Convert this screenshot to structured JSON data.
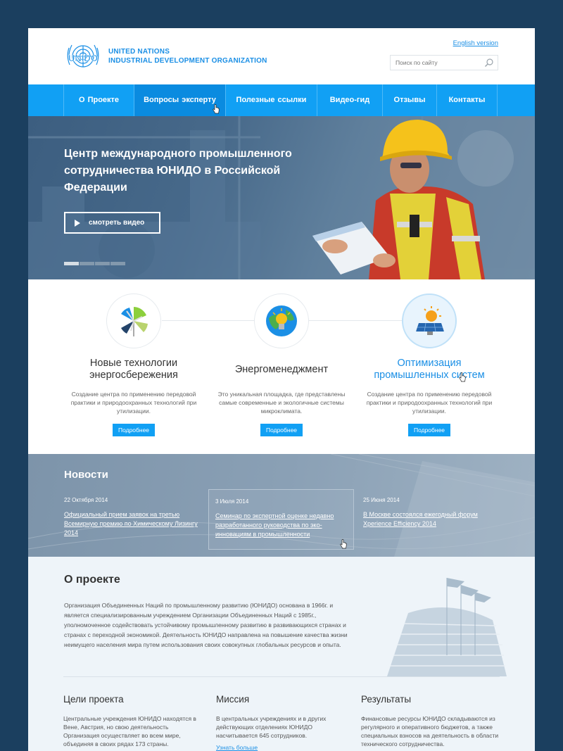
{
  "header": {
    "org_line1": "UNITED NATIONS",
    "org_line2": "INDUSTRIAL DEVELOPMENT ORGANIZATION",
    "logo_text": "UNIDO",
    "lang_link": "English version",
    "search_placeholder": "Поиск по сайту"
  },
  "nav": {
    "items": [
      {
        "label": "О Проекте"
      },
      {
        "label": "Вопросы эксперту"
      },
      {
        "label": "Полезные ссылки"
      },
      {
        "label": "Видео-гид"
      },
      {
        "label": "Отзывы"
      },
      {
        "label": "Контакты"
      }
    ],
    "active_index": 1
  },
  "hero": {
    "title": "Центр международного промышленного сотрудничества ЮНИДО в Российской Федерации",
    "button_label": "смотреть видео",
    "slides_count": 4,
    "active_slide": 0
  },
  "features": [
    {
      "icon": "wind-turbine-icon",
      "title": "Новые технологии энергосбережения",
      "text": "Создание центра по применению передовой практики и природоохранных технологий при утилизации.",
      "button": "Подробнее",
      "highlighted": false
    },
    {
      "icon": "lightbulb-globe-icon",
      "title": "Энергоменеджмент",
      "text": "Это уникальная площадка, где представлены самые современные и экологичные системы микроклимата.",
      "button": "Подробнее",
      "highlighted": false
    },
    {
      "icon": "solar-panel-icon",
      "title": "Оптимизация промышленных систем",
      "text": "Создание центра по применению передовой практики и природоохранных технологий при утилизации.",
      "button": "Подробнее",
      "highlighted": true
    }
  ],
  "news": {
    "heading": "Новости",
    "items": [
      {
        "date": "22 Октября 2014",
        "title": "Официальный прием заявок на третью Всемирную премию по Химическому Лизингу 2014"
      },
      {
        "date": "3 Июля 2014",
        "title": "Семинар по экспертной оценке недавно разработанного руководства по эко-инновациям в промышленности"
      },
      {
        "date": "25 Июня 2014",
        "title": "В Москве состоялся ежегодный форум Xperience Efficiency 2014"
      }
    ]
  },
  "about": {
    "heading": "О проекте",
    "text": "Организация Объединенных Наций по промышленному развитию (ЮНИДО) основана в 1966г. и является специализированным учреждением Организации Объединенных Наций с 1985г., уполномоченное содействовать устойчивому промышленному развитию в развивающихся странах и странах с переходной экономикой. Деятельность ЮНИДО направлена на повышение качества жизни неимущего населения мира путем использования своих совокупных глобальных ресурсов и опыта."
  },
  "columns": [
    {
      "title": "Цели проекта",
      "text": "Центральные учреждения ЮНИДО находятся в Вене, Австрия, но свою деятельность Организация осуществляет во всем мире, объединяя в своих рядах 173 страны.",
      "link": ""
    },
    {
      "title": "Миссия",
      "text": "В центральных учреждениях и в других действующих отделениях ЮНИДО насчитывается 645 сотрудников.",
      "link": "Узнать больше"
    },
    {
      "title": "Результаты",
      "text": "Финансовые ресурсы ЮНИДО складываются из регулярного и оперативного бюджетов, а также специальных взносов на деятельность в области технического сотрудничества.",
      "link": ""
    }
  ],
  "colors": {
    "outer_bg": "#1b3f5f",
    "brand_blue": "#11a0f4",
    "link_blue": "#1b8fe5",
    "nav_active": "#0a8be0"
  }
}
